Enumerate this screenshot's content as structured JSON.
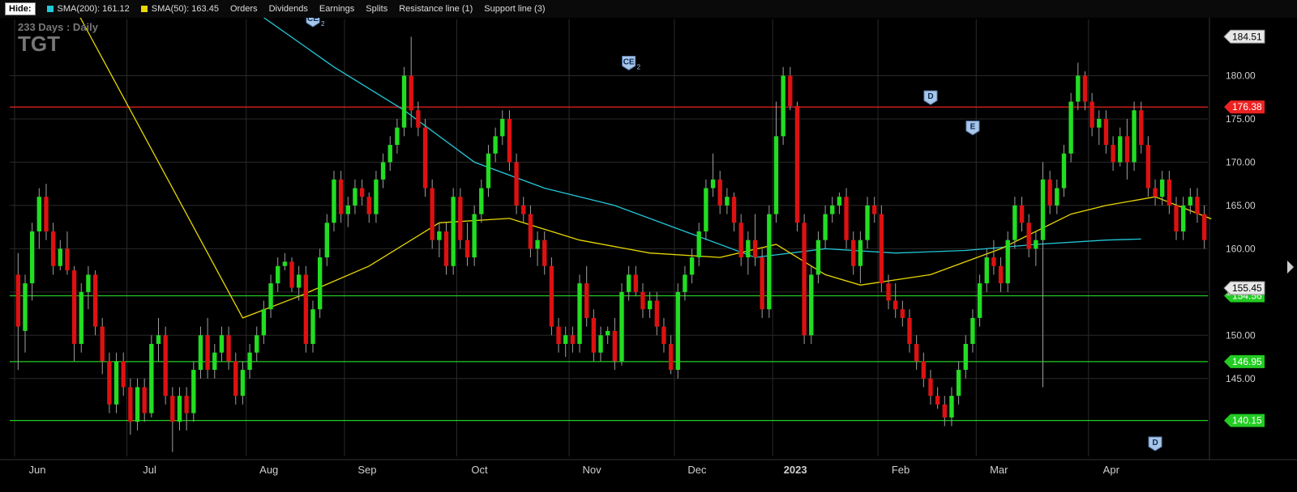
{
  "toolbar": {
    "hide_label": "Hide:",
    "items": [
      {
        "label": "SMA(200): 161.12",
        "color": "#22c8d8"
      },
      {
        "label": "SMA(50): 163.45",
        "color": "#e8d800"
      },
      {
        "label": "Orders"
      },
      {
        "label": "Dividends"
      },
      {
        "label": "Earnings"
      },
      {
        "label": "Splits"
      },
      {
        "label": "Resistance line (1)"
      },
      {
        "label": "Support line (3)"
      }
    ]
  },
  "header": {
    "period": "233  Days : Daily",
    "symbol": "TGT"
  },
  "colors": {
    "up": "#22dd22",
    "down": "#dd1111",
    "sma200": "#22c8d8",
    "sma50": "#e8d800",
    "resistance": "#ee2222",
    "support": "#22cc22",
    "grid": "#2a2a2a"
  },
  "chart_data": {
    "type": "candlestick",
    "ylim": [
      136,
      186.5
    ],
    "yticks": [
      145,
      150,
      155,
      160,
      165,
      170,
      175,
      180
    ],
    "x_months": [
      "Jun",
      "Jul",
      "Aug",
      "Sep",
      "Oct",
      "Nov",
      "Dec",
      "2023",
      "Feb",
      "Mar",
      "Apr"
    ],
    "price_label": "155.45",
    "top_label": "184.51",
    "resistance": [
      {
        "value": 176.38,
        "label": "176.38"
      }
    ],
    "support": [
      {
        "value": 154.56,
        "label": "154.56"
      },
      {
        "value": 146.95,
        "label": "146.95"
      },
      {
        "value": 140.15,
        "label": "140.15"
      }
    ],
    "sma200": [
      [
        24,
        193
      ],
      [
        45,
        181
      ],
      [
        55,
        176
      ],
      [
        65,
        170
      ],
      [
        75,
        167
      ],
      [
        85,
        165
      ],
      [
        95,
        162
      ],
      [
        105,
        159
      ],
      [
        115,
        160
      ],
      [
        125,
        159.5
      ],
      [
        135,
        159.8
      ],
      [
        145,
        160.5
      ],
      [
        155,
        161
      ],
      [
        160,
        161.12
      ]
    ],
    "sma50": [
      [
        0,
        200
      ],
      [
        10,
        185
      ],
      [
        20,
        170
      ],
      [
        28,
        158
      ],
      [
        32,
        152
      ],
      [
        40,
        154.5
      ],
      [
        50,
        158
      ],
      [
        60,
        163
      ],
      [
        70,
        163.5
      ],
      [
        80,
        161
      ],
      [
        90,
        159.5
      ],
      [
        100,
        159
      ],
      [
        108,
        160.5
      ],
      [
        115,
        157
      ],
      [
        120,
        155.8
      ],
      [
        130,
        157
      ],
      [
        140,
        160
      ],
      [
        150,
        164
      ],
      [
        155,
        165
      ],
      [
        162,
        166
      ],
      [
        170,
        163.45
      ]
    ],
    "events": [
      {
        "label": "CE",
        "sub": "2",
        "x": 42,
        "value": 186.5
      },
      {
        "label": "CE",
        "sub": "2",
        "x": 87,
        "value": 181.5
      },
      {
        "label": "D",
        "sub": "",
        "x": 130,
        "value": 177.5
      },
      {
        "label": "E",
        "sub": "",
        "x": 136,
        "value": 174
      },
      {
        "label": "D",
        "sub": "",
        "x": 162,
        "value": 137.5
      }
    ],
    "candles": [
      [
        157.0,
        159.5,
        146.0,
        151.0
      ],
      [
        150.5,
        157.0,
        148.0,
        156.0
      ],
      [
        156.0,
        163.0,
        154.0,
        162.0
      ],
      [
        162.0,
        167.0,
        160.0,
        166.0
      ],
      [
        166.0,
        167.5,
        161.0,
        162.0
      ],
      [
        162.0,
        163.0,
        157.0,
        158.0
      ],
      [
        158.0,
        161.0,
        157.5,
        160.0
      ],
      [
        160.0,
        162.0,
        157.0,
        157.5
      ],
      [
        157.5,
        158.0,
        147.0,
        149.0
      ],
      [
        149.0,
        156.0,
        148.0,
        155.0
      ],
      [
        155.0,
        158.0,
        153.0,
        157.0
      ],
      [
        157.0,
        157.5,
        150.0,
        151.0
      ],
      [
        151.0,
        152.0,
        145.5,
        147.0
      ],
      [
        147.0,
        148.0,
        141.0,
        142.0
      ],
      [
        142.0,
        148.0,
        141.0,
        147.0
      ],
      [
        147.0,
        148.0,
        143.0,
        144.0
      ],
      [
        144.0,
        145.0,
        138.5,
        140.0
      ],
      [
        140.0,
        145.0,
        139.0,
        144.0
      ],
      [
        144.0,
        145.0,
        140.0,
        141.0
      ],
      [
        141.0,
        150.0,
        140.5,
        149.0
      ],
      [
        149.0,
        152.0,
        147.0,
        150.0
      ],
      [
        150.0,
        151.0,
        142.0,
        143.0
      ],
      [
        143.0,
        144.0,
        136.5,
        140.0
      ],
      [
        140.0,
        144.0,
        139.0,
        143.0
      ],
      [
        143.0,
        144.0,
        139.0,
        141.0
      ],
      [
        141.0,
        147.0,
        140.0,
        146.0
      ],
      [
        146.0,
        151.0,
        145.0,
        150.0
      ],
      [
        150.0,
        152.0,
        145.0,
        146.0
      ],
      [
        146.0,
        149.0,
        145.0,
        148.0
      ],
      [
        148.0,
        151.0,
        147.0,
        150.0
      ],
      [
        150.0,
        151.0,
        146.0,
        147.0
      ],
      [
        147.0,
        148.0,
        142.0,
        143.0
      ],
      [
        143.0,
        147.0,
        142.0,
        146.0
      ],
      [
        146.0,
        149.0,
        145.0,
        148.0
      ],
      [
        148.0,
        151.0,
        147.0,
        150.0
      ],
      [
        150.0,
        154.0,
        149.0,
        153.0
      ],
      [
        153.0,
        157.0,
        152.0,
        156.0
      ],
      [
        156.0,
        159.0,
        155.0,
        158.0
      ],
      [
        158.0,
        159.5,
        157.5,
        158.5
      ],
      [
        158.5,
        159.0,
        155.0,
        155.5
      ],
      [
        155.5,
        158.0,
        154.0,
        157.0
      ],
      [
        157.0,
        158.0,
        148.0,
        149.0
      ],
      [
        149.0,
        154.0,
        148.0,
        153.0
      ],
      [
        153.0,
        160.0,
        152.0,
        159.0
      ],
      [
        159.0,
        164.0,
        158.0,
        163.0
      ],
      [
        163.0,
        169.0,
        162.0,
        168.0
      ],
      [
        168.0,
        169.0,
        163.0,
        164.0
      ],
      [
        164.0,
        166.0,
        162.5,
        165.0
      ],
      [
        165.0,
        168.0,
        164.0,
        167.0
      ],
      [
        167.0,
        168.0,
        165.0,
        166.0
      ],
      [
        166.0,
        166.5,
        163.0,
        164.0
      ],
      [
        164.0,
        169.0,
        163.0,
        168.0
      ],
      [
        168.0,
        171.0,
        167.0,
        170.0
      ],
      [
        170.0,
        173.0,
        169.0,
        172.0
      ],
      [
        172.0,
        175.0,
        171.0,
        174.0
      ],
      [
        174.0,
        181.0,
        173.0,
        180.0
      ],
      [
        180.0,
        184.5,
        174.0,
        176.0
      ],
      [
        176.0,
        177.0,
        173.0,
        174.0
      ],
      [
        174.0,
        175.0,
        166.0,
        167.0
      ],
      [
        167.0,
        168.0,
        160.0,
        161.0
      ],
      [
        161.0,
        163.0,
        159.0,
        162.0
      ],
      [
        162.0,
        163.0,
        157.0,
        158.0
      ],
      [
        158.0,
        167.0,
        157.0,
        166.0
      ],
      [
        166.0,
        167.0,
        160.0,
        161.0
      ],
      [
        161.0,
        163.0,
        158.0,
        159.0
      ],
      [
        159.0,
        165.0,
        158.0,
        164.0
      ],
      [
        164.0,
        168.0,
        163.0,
        167.0
      ],
      [
        167.0,
        172.0,
        166.0,
        171.0
      ],
      [
        171.0,
        174.0,
        170.0,
        173.0
      ],
      [
        173.0,
        176.0,
        172.0,
        175.0
      ],
      [
        175.0,
        176.0,
        169.0,
        170.0
      ],
      [
        170.0,
        171.0,
        164.0,
        165.0
      ],
      [
        165.0,
        166.0,
        163.0,
        164.0
      ],
      [
        164.0,
        165.0,
        159.0,
        160.0
      ],
      [
        160.0,
        162.0,
        158.0,
        161.0
      ],
      [
        161.0,
        162.0,
        157.0,
        158.0
      ],
      [
        158.0,
        159.0,
        150.0,
        151.0
      ],
      [
        151.0,
        152.0,
        148.0,
        149.0
      ],
      [
        149.0,
        151.0,
        147.5,
        150.0
      ],
      [
        150.0,
        151.0,
        148.0,
        149.0
      ],
      [
        149.0,
        157.0,
        148.0,
        156.0
      ],
      [
        156.0,
        158.0,
        151.0,
        152.0
      ],
      [
        152.0,
        153.0,
        147.0,
        148.0
      ],
      [
        148.0,
        151.0,
        147.0,
        150.0
      ],
      [
        150.0,
        151.0,
        149.0,
        150.5
      ],
      [
        150.5,
        152.0,
        146.0,
        147.0
      ],
      [
        147.0,
        156.0,
        146.5,
        155.0
      ],
      [
        155.0,
        158.0,
        154.0,
        157.0
      ],
      [
        157.0,
        158.0,
        154.5,
        155.0
      ],
      [
        155.0,
        156.0,
        152.0,
        153.0
      ],
      [
        153.0,
        155.0,
        152.0,
        154.0
      ],
      [
        154.0,
        155.0,
        150.0,
        151.0
      ],
      [
        151.0,
        152.0,
        148.0,
        149.0
      ],
      [
        149.0,
        150.0,
        145.5,
        146.0
      ],
      [
        146.0,
        156.0,
        145.0,
        155.0
      ],
      [
        155.0,
        158.0,
        154.0,
        157.0
      ],
      [
        157.0,
        160.0,
        156.0,
        159.0
      ],
      [
        159.0,
        163.0,
        158.0,
        162.0
      ],
      [
        162.0,
        168.0,
        161.0,
        167.0
      ],
      [
        167.0,
        171.0,
        166.0,
        168.0
      ],
      [
        168.0,
        169.0,
        164.0,
        165.0
      ],
      [
        165.0,
        167.0,
        164.0,
        166.0
      ],
      [
        166.0,
        166.5,
        162.0,
        163.0
      ],
      [
        163.0,
        164.0,
        158.0,
        159.0
      ],
      [
        159.0,
        162.0,
        157.0,
        161.0
      ],
      [
        161.0,
        164.0,
        158.0,
        159.0
      ],
      [
        159.0,
        160.0,
        152.0,
        153.0
      ],
      [
        153.0,
        165.0,
        152.0,
        164.0
      ],
      [
        164.0,
        177.0,
        163.0,
        173.0
      ],
      [
        173.0,
        181.0,
        172.0,
        180.0
      ],
      [
        180.0,
        181.0,
        176.0,
        176.5
      ],
      [
        176.5,
        177.0,
        162.0,
        163.0
      ],
      [
        163.0,
        164.0,
        149.0,
        150.0
      ],
      [
        150.0,
        158.0,
        149.0,
        157.0
      ],
      [
        157.0,
        162.0,
        156.0,
        161.0
      ],
      [
        161.0,
        165.0,
        160.0,
        164.0
      ],
      [
        164.0,
        166.0,
        163.0,
        165.0
      ],
      [
        165.0,
        166.5,
        164.0,
        166.0
      ],
      [
        166.0,
        167.0,
        160.0,
        161.0
      ],
      [
        161.0,
        162.0,
        157.0,
        158.0
      ],
      [
        158.0,
        162.0,
        156.0,
        161.0
      ],
      [
        161.0,
        166.0,
        160.0,
        165.0
      ],
      [
        165.0,
        166.0,
        163.0,
        164.0
      ],
      [
        164.0,
        165.0,
        155.0,
        156.0
      ],
      [
        156.0,
        157.0,
        153.0,
        154.0
      ],
      [
        154.0,
        156.0,
        152.0,
        153.0
      ],
      [
        153.0,
        154.0,
        151.0,
        152.0
      ],
      [
        152.0,
        153.0,
        148.0,
        149.0
      ],
      [
        149.0,
        150.0,
        146.0,
        147.0
      ],
      [
        147.0,
        148.0,
        144.0,
        145.0
      ],
      [
        145.0,
        146.0,
        142.0,
        143.0
      ],
      [
        143.0,
        144.0,
        141.5,
        142.0
      ],
      [
        142.0,
        143.0,
        139.5,
        140.5
      ],
      [
        140.5,
        144.0,
        139.5,
        143.0
      ],
      [
        143.0,
        147.0,
        142.0,
        146.0
      ],
      [
        146.0,
        150.0,
        145.0,
        149.0
      ],
      [
        149.0,
        153.0,
        148.0,
        152.0
      ],
      [
        152.0,
        157.0,
        151.0,
        156.0
      ],
      [
        156.0,
        160.0,
        155.0,
        159.0
      ],
      [
        159.0,
        161.0,
        157.0,
        158.0
      ],
      [
        158.0,
        159.0,
        155.0,
        156.0
      ],
      [
        156.0,
        162.0,
        155.0,
        161.0
      ],
      [
        161.0,
        166.0,
        160.0,
        165.0
      ],
      [
        165.0,
        166.0,
        162.0,
        163.0
      ],
      [
        163.0,
        164.0,
        159.0,
        160.0
      ],
      [
        160.0,
        162.0,
        158.0,
        161.0
      ],
      [
        161.0,
        170.0,
        144.0,
        168.0
      ],
      [
        168.0,
        169.0,
        164.0,
        165.0
      ],
      [
        165.0,
        168.0,
        164.0,
        167.0
      ],
      [
        167.0,
        172.0,
        166.0,
        171.0
      ],
      [
        171.0,
        178.0,
        170.0,
        177.0
      ],
      [
        177.0,
        181.5,
        176.0,
        180.0
      ],
      [
        180.0,
        180.5,
        176.0,
        177.0
      ],
      [
        177.0,
        178.0,
        173.0,
        174.0
      ],
      [
        174.0,
        176.0,
        172.0,
        175.0
      ],
      [
        175.0,
        176.0,
        171.0,
        172.0
      ],
      [
        172.0,
        173.0,
        169.0,
        170.0
      ],
      [
        170.0,
        174.0,
        169.5,
        173.0
      ],
      [
        173.0,
        175.0,
        168.0,
        170.0
      ],
      [
        170.0,
        177.0,
        169.0,
        176.0
      ],
      [
        176.0,
        177.0,
        171.0,
        172.0
      ],
      [
        172.0,
        173.0,
        166.0,
        167.0
      ],
      [
        167.0,
        168.0,
        165.0,
        166.0
      ],
      [
        166.0,
        169.0,
        165.0,
        168.0
      ],
      [
        168.0,
        169.0,
        164.0,
        165.0
      ],
      [
        165.0,
        166.0,
        161.0,
        162.0
      ],
      [
        162.0,
        166.0,
        161.0,
        165.0
      ],
      [
        165.0,
        167.0,
        164.0,
        166.0
      ],
      [
        166.0,
        167.0,
        163.0,
        164.0
      ],
      [
        164.0,
        165.0,
        160.0,
        161.0
      ]
    ]
  }
}
